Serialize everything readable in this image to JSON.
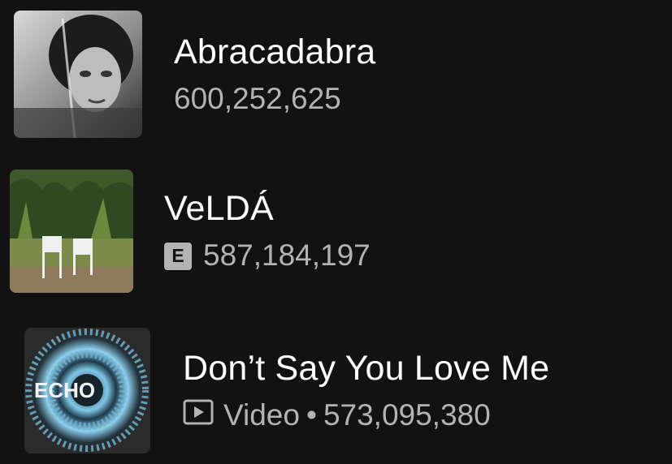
{
  "tracks": [
    {
      "title": "Abracadabra",
      "plays": "600,252,625",
      "explicit": false
    },
    {
      "title": "VeLDÁ",
      "plays": "587,184,197",
      "explicit": true,
      "explicit_label": "E"
    },
    {
      "title": "Don’t Say You Love Me",
      "type_label": "Video",
      "separator": "•",
      "plays": "573,095,380",
      "icon": "video-icon"
    }
  ],
  "artwork": {
    "track3_text": "ECHO"
  },
  "colors": {
    "background": "#121212",
    "primary_text": "#ffffff",
    "secondary_text": "#b3b3b3"
  }
}
